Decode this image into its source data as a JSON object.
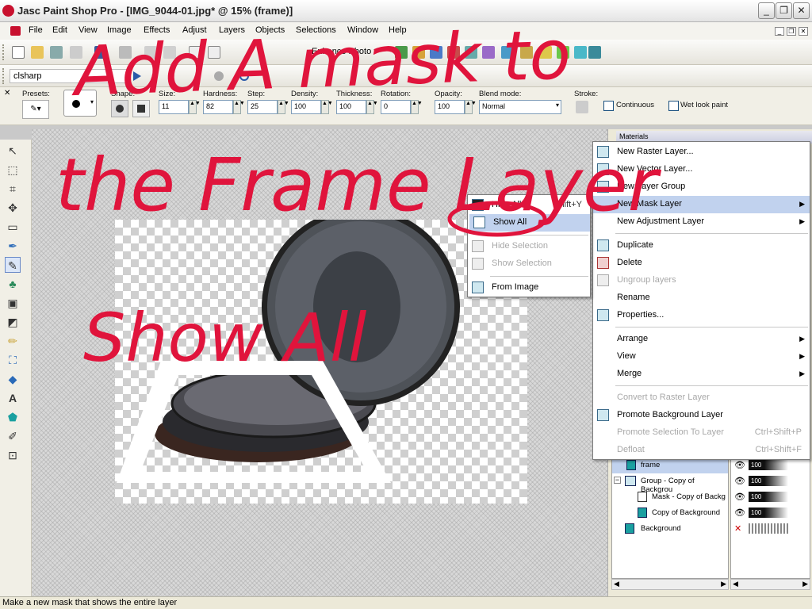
{
  "window": {
    "title": "Jasc Paint Shop Pro - [IMG_9044-01.jpg* @  15% (frame)]"
  },
  "menubar": {
    "items": [
      "File",
      "Edit",
      "View",
      "Image",
      "Effects",
      "Adjust",
      "Layers",
      "Objects",
      "Selections",
      "Window",
      "Help"
    ]
  },
  "toolbar": {
    "enhance_photo": "Enhance Photo",
    "script_name": "clsharp"
  },
  "tool_options": {
    "presets_label": "Presets:",
    "shape_label": "Shape:",
    "size_label": "Size:",
    "size_value": "11",
    "hardness_label": "Hardness:",
    "hardness_value": "82",
    "step_label": "Step:",
    "step_value": "25",
    "density_label": "Density:",
    "density_value": "100",
    "thickness_label": "Thickness:",
    "thickness_value": "100",
    "rotation_label": "Rotation:",
    "rotation_value": "0",
    "opacity_label": "Opacity:",
    "opacity_value": "100",
    "blend_mode_label": "Blend mode:",
    "blend_mode_value": "Normal",
    "stroke_label": "Stroke:",
    "continuous_label": "Continuous",
    "wet_look_label": "Wet look paint"
  },
  "panels": {
    "materials_title": "Materials"
  },
  "layers": [
    {
      "name": "frame",
      "opacity": "100"
    },
    {
      "name": "Group - Copy of Backgrou",
      "opacity": "100"
    },
    {
      "name": "Mask - Copy of Backg",
      "opacity": "100"
    },
    {
      "name": "Copy of Background",
      "opacity": "100"
    },
    {
      "name": "Background",
      "opacity": ""
    }
  ],
  "layers_context_menu": {
    "items": [
      {
        "label": "New Raster Layer...",
        "disabled": false
      },
      {
        "label": "New Vector Layer...",
        "disabled": false
      },
      {
        "label": "New Layer Group",
        "disabled": false
      },
      {
        "label": "New Mask Layer",
        "disabled": false,
        "submenu": true
      },
      {
        "label": "New Adjustment Layer",
        "disabled": false,
        "submenu": true
      },
      {
        "label": "Duplicate",
        "disabled": false
      },
      {
        "label": "Delete",
        "disabled": false
      },
      {
        "label": "Ungroup layers",
        "disabled": true
      },
      {
        "label": "Rename",
        "disabled": false
      },
      {
        "label": "Properties...",
        "disabled": false
      },
      {
        "label": "Arrange",
        "disabled": false,
        "submenu": true
      },
      {
        "label": "View",
        "disabled": false,
        "submenu": true
      },
      {
        "label": "Merge",
        "disabled": false,
        "submenu": true
      },
      {
        "label": "Convert to Raster Layer",
        "disabled": true
      },
      {
        "label": "Promote Background Layer",
        "disabled": false
      },
      {
        "label": "Promote Selection To Layer",
        "disabled": true,
        "shortcut": "Ctrl+Shift+P"
      },
      {
        "label": "Defloat",
        "disabled": true,
        "shortcut": "Ctrl+Shift+F"
      }
    ]
  },
  "mask_submenu": {
    "items": [
      {
        "label": "Hide All",
        "shortcut": "Shift+Y",
        "disabled": false
      },
      {
        "label": "Show All",
        "shortcut": "",
        "disabled": false
      },
      {
        "label": "Hide Selection",
        "shortcut": "",
        "disabled": true
      },
      {
        "label": "Show Selection",
        "shortcut": "",
        "disabled": true
      },
      {
        "label": "From Image",
        "shortcut": "",
        "disabled": false
      }
    ]
  },
  "status": {
    "text": "Make a new mask that shows the entire layer"
  },
  "annotation": {
    "line1": "Add A mask to",
    "line2": "the Frame Layer",
    "line3": "Show All"
  },
  "colors": {
    "annotation": "#e0143c",
    "menu_highlight": "#c1d2ee"
  }
}
